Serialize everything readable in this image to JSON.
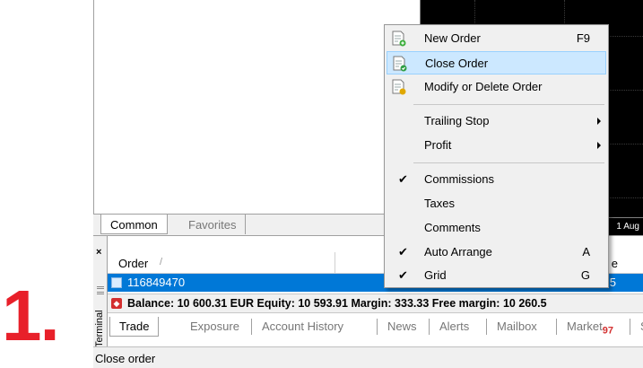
{
  "step_label": "1.",
  "navigator": {
    "tabs": [
      {
        "label": "Common"
      },
      {
        "label": "Favorites"
      }
    ]
  },
  "chart": {
    "date_label": "1 Aug"
  },
  "context_menu": {
    "items": [
      {
        "label": "New Order",
        "shortcut": "F9",
        "icon": "new-order-icon"
      },
      {
        "label": "Close Order",
        "icon": "close-order-icon"
      },
      {
        "label": "Modify or Delete Order",
        "icon": "modify-order-icon"
      },
      {
        "label": "Trailing Stop"
      },
      {
        "label": "Profit"
      },
      {
        "label": "Commissions",
        "check": "✔"
      },
      {
        "label": "Taxes"
      },
      {
        "label": "Comments"
      },
      {
        "label": "Auto Arrange",
        "shortcut": "A",
        "check": "✔"
      },
      {
        "label": "Grid",
        "shortcut": "G",
        "check": "✔"
      }
    ]
  },
  "terminal": {
    "close": "×",
    "side_label": "Terminal",
    "columns": {
      "order": "Order",
      "sort_mark": "/",
      "tail": "e"
    },
    "order_row": {
      "ticket": "116849470",
      "tail": "5"
    },
    "balance_line": "Balance: 10 600.31 EUR  Equity: 10 593.91  Margin: 333.33  Free margin: 10 260.5",
    "tabs": [
      {
        "label": "Trade"
      },
      {
        "label": "Exposure"
      },
      {
        "label": "Account History"
      },
      {
        "label": "News"
      },
      {
        "label": "Alerts"
      },
      {
        "label": "Mailbox"
      },
      {
        "label": "Market",
        "badge": "97"
      },
      {
        "label": "S"
      }
    ]
  },
  "status_bar": {
    "text": "Close order"
  },
  "colors": {
    "selection": "#0078d7",
    "menu_highlight": "#cce8ff",
    "step_red": "#e8202a"
  }
}
